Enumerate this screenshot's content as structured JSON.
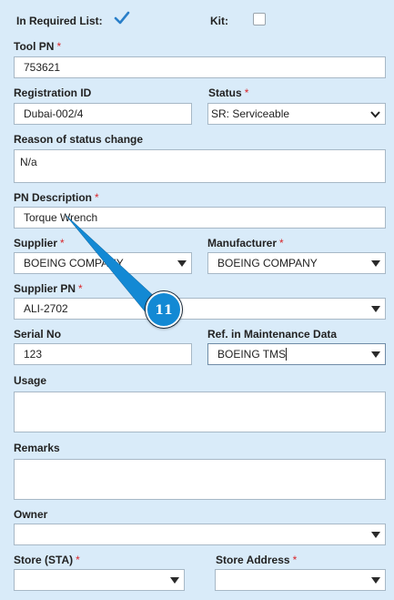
{
  "in_required_list": {
    "label": "In Required List:",
    "checked": true
  },
  "kit": {
    "label": "Kit:",
    "checked": false
  },
  "tool_pn": {
    "label": "Tool PN",
    "required": "*",
    "value": "753621"
  },
  "registration_id": {
    "label": "Registration ID",
    "value": "Dubai-002/4"
  },
  "status": {
    "label": "Status",
    "required": "*",
    "value": "SR: Serviceable"
  },
  "reason": {
    "label": "Reason of status change",
    "value": "N/a"
  },
  "pn_description": {
    "label": "PN Description",
    "required": "*",
    "value": "Torque Wrench"
  },
  "supplier": {
    "label": "Supplier",
    "required": "*",
    "value": "BOEING COMPANY"
  },
  "manufacturer": {
    "label": "Manufacturer",
    "required": "*",
    "value": "BOEING COMPANY"
  },
  "supplier_pn": {
    "label": "Supplier PN",
    "required": "*",
    "value": "ALI-2702"
  },
  "serial_no": {
    "label": "Serial No",
    "value": "123"
  },
  "ref_maintenance": {
    "label": "Ref. in Maintenance Data",
    "value": "BOEING TMS"
  },
  "usage": {
    "label": "Usage",
    "value": ""
  },
  "remarks": {
    "label": "Remarks",
    "value": ""
  },
  "owner": {
    "label": "Owner",
    "value": ""
  },
  "store_sta": {
    "label": "Store (STA)",
    "required": "*",
    "value": ""
  },
  "store_address": {
    "label": "Store Address",
    "required": "*",
    "value": ""
  },
  "callout": {
    "number": "11"
  },
  "colors": {
    "background": "#d9ebf9",
    "required": "#d9262b",
    "accent": "#1389d4",
    "check": "#2a7fc9"
  }
}
